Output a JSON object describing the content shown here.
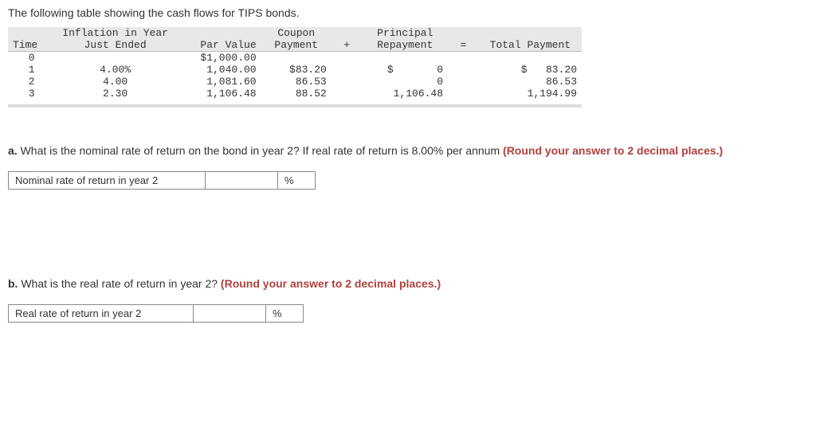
{
  "intro": "The following table showing the cash flows for TIPS bonds.",
  "table": {
    "headers": {
      "time": "Time",
      "inflation_top": "Inflation in Year",
      "inflation_bot": "Just Ended",
      "par": "Par Value",
      "coupon_top": "Coupon",
      "coupon_bot": "Payment",
      "plus": "+",
      "principal_top": "Principal",
      "principal_bot": "Repayment",
      "eq": "=",
      "total": "Total Payment"
    },
    "rows": [
      {
        "time": "0",
        "inflation": "",
        "par": "$1,000.00",
        "coupon": "",
        "principal": "",
        "total": ""
      },
      {
        "time": "1",
        "inflation": "4.00%",
        "par": "1,040.00",
        "coupon": "$83.20",
        "principal": "$       0",
        "total": "$   83.20"
      },
      {
        "time": "2",
        "inflation": "4.00",
        "par": "1,081.60",
        "coupon": "86.53",
        "principal": "0",
        "total": "86.53"
      },
      {
        "time": "3",
        "inflation": "2.30",
        "par": "1,106.48",
        "coupon": "88.52",
        "principal": "1,106.48",
        "total": "1,194.99"
      }
    ]
  },
  "qa": {
    "part": "a.",
    "text": " What is the nominal rate of return on the bond in year 2? If real rate of return is 8.00% per annum ",
    "hint": "(Round your answer to 2 decimal places.)",
    "label": "Nominal rate of return in year 2",
    "unit": "%"
  },
  "qb": {
    "part": "b.",
    "text": " What is the real rate of return in year 2? ",
    "hint": "(Round your answer to 2 decimal places.)",
    "label": "Real rate of return in year 2",
    "unit": "%"
  },
  "chart_data": {
    "type": "table",
    "title": "Cash flows for TIPS bonds",
    "columns": [
      "Time",
      "Inflation in Year Just Ended",
      "Par Value",
      "Coupon Payment",
      "Principal Repayment",
      "Total Payment"
    ],
    "rows": [
      [
        0,
        null,
        1000.0,
        null,
        null,
        null
      ],
      [
        1,
        4.0,
        1040.0,
        83.2,
        0,
        83.2
      ],
      [
        2,
        4.0,
        1081.6,
        86.53,
        0,
        86.53
      ],
      [
        3,
        2.3,
        1106.48,
        88.52,
        1106.48,
        1194.99
      ]
    ]
  }
}
